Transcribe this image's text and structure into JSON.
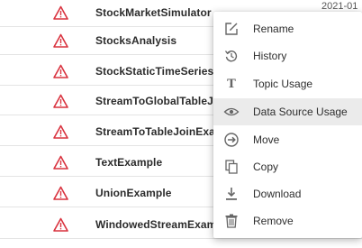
{
  "rows": [
    {
      "name": "StockMarketSimulator",
      "date_partial": "2021-01",
      "icon": "warning-triangle-icon"
    },
    {
      "name": "StocksAnalysis",
      "icon": "warning-triangle-icon"
    },
    {
      "name": "StockStaticTimeSeriesAp",
      "icon": "warning-triangle-icon"
    },
    {
      "name": "StreamToGlobalTableJoin",
      "icon": "warning-triangle-icon"
    },
    {
      "name": "StreamToTableJoinExamp",
      "icon": "warning-triangle-icon"
    },
    {
      "name": "TextExample",
      "icon": "warning-triangle-icon"
    },
    {
      "name": "UnionExample",
      "icon": "warning-triangle-icon"
    },
    {
      "name": "WindowedStreamExamp",
      "icon": "warning-triangle-icon"
    }
  ],
  "context_menu": {
    "highlighted": "Data Source Usage",
    "items": [
      {
        "label": "Rename",
        "icon": "edit-icon"
      },
      {
        "label": "History",
        "icon": "history-icon"
      },
      {
        "label": "Topic Usage",
        "icon": "topic-icon"
      },
      {
        "label": "Data Source Usage",
        "icon": "eye-icon"
      },
      {
        "label": "Move",
        "icon": "move-icon"
      },
      {
        "label": "Copy",
        "icon": "copy-icon"
      },
      {
        "label": "Download",
        "icon": "download-icon"
      },
      {
        "label": "Remove",
        "icon": "trash-icon"
      }
    ]
  },
  "colors": {
    "warning": "#d9333f",
    "menu_highlight": "#ebebeb",
    "icon_gray": "#666666"
  }
}
